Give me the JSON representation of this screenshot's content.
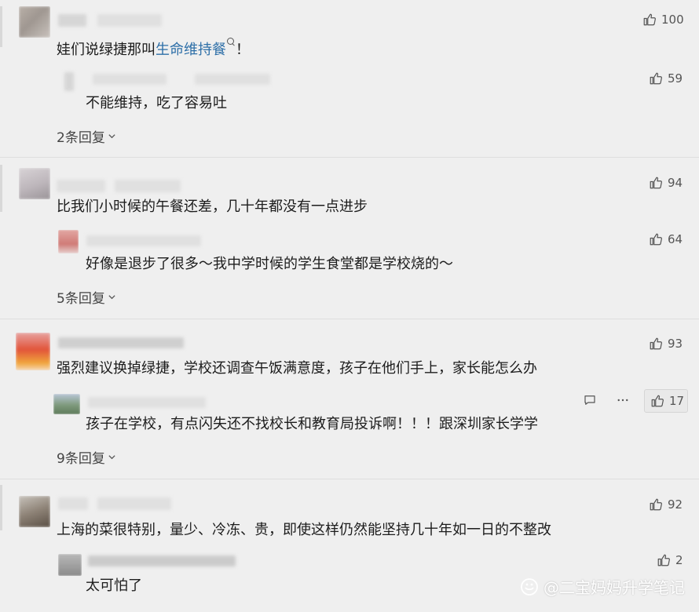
{
  "comments": [
    {
      "text_before_link": "娃们说绿捷那叫",
      "link_text": "生命维持餐",
      "link_icon": "search-icon",
      "text_after_link": "！",
      "likes": "100",
      "reply": {
        "text": "不能维持，吃了容易吐",
        "likes": "59"
      },
      "replies_label": "2条回复"
    },
    {
      "text": "比我们小时候的午餐还差，几十年都没有一点进步",
      "likes": "94",
      "reply": {
        "text": "好像是退步了很多～我中学时候的学生食堂都是学校烧的～",
        "likes": "64"
      },
      "replies_label": "5条回复"
    },
    {
      "text": "强烈建议换掉绿捷，学校还调查午饭满意度，孩子在他们手上，家长能怎么办",
      "likes": "93",
      "reply": {
        "text": "孩子在学校，有点闪失还不找校长和教育局投诉啊！！！跟深圳家长学学",
        "likes": "17"
      },
      "replies_label": "9条回复"
    },
    {
      "text": "上海的菜很特别，量少、冷冻、贵，即使这样仍然能坚持几十年如一日的不整改",
      "likes": "92",
      "reply": {
        "text": "太可怕了",
        "likes": "2"
      }
    }
  ],
  "icons": {
    "like": "thumbs-up-icon",
    "comment": "comment-icon",
    "more": "more-icon",
    "chevron": "chevron-down-icon"
  },
  "watermark": {
    "text": "@二宝妈妈升学笔记"
  },
  "colors": {
    "background": "#efefef",
    "link": "#2e6fa8"
  }
}
